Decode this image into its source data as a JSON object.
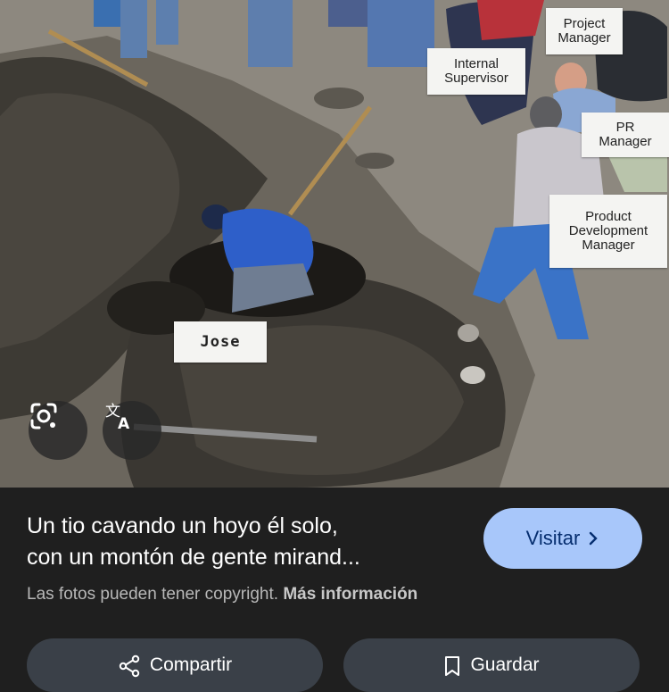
{
  "photo": {
    "labels": {
      "project_manager": "Project\nManager",
      "internal_supervisor": "Internal\nSupervisor",
      "pr_manager": "PR\nManager",
      "product_dev_manager": "Product\nDevelopment\nManager",
      "jose": "Jose"
    },
    "icons": {
      "lens": "google-lens-icon",
      "translate": "translate-icon"
    }
  },
  "result": {
    "caption": "Un tio cavando un hoyo él solo,\ncon un montón de gente mirand...",
    "visit_label": "Visitar",
    "copyright_text": "Las fotos pueden tener copyright.",
    "more_info_label": "Más información"
  },
  "actions": {
    "share_label": "Compartir",
    "save_label": "Guardar"
  },
  "colors": {
    "background": "#1f1f1f",
    "visit_button": "#a8c7fa",
    "action_button": "#3a4048"
  }
}
